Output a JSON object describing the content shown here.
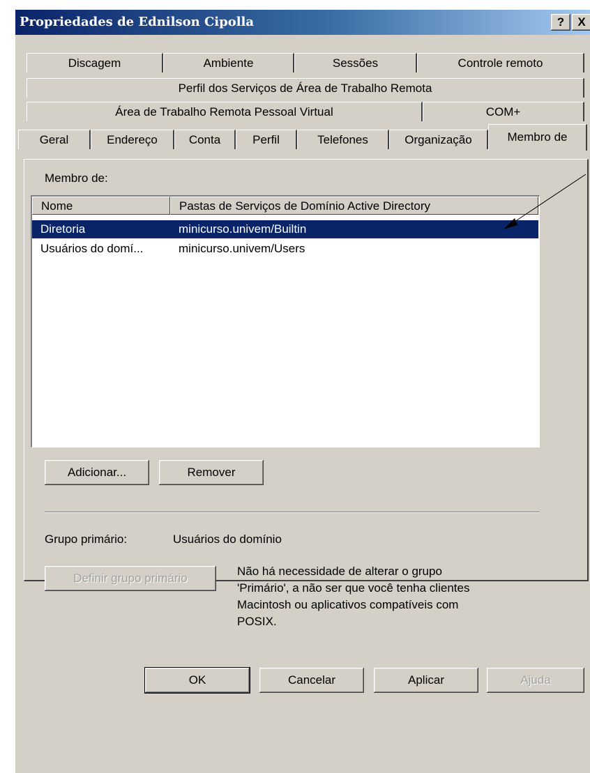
{
  "window": {
    "title": "Propriedades de Ednilson Cipolla",
    "help_button": "?",
    "close_button": "X"
  },
  "tabs": {
    "row1": [
      "Discagem",
      "Ambiente",
      "Sessões",
      "Controle remoto"
    ],
    "row2": [
      "Perfil dos Serviços de Área de Trabalho Remota"
    ],
    "row3": [
      "Área de Trabalho Remota Pessoal Virtual",
      "COM+"
    ],
    "row4": [
      "Geral",
      "Endereço",
      "Conta",
      "Perfil",
      "Telefones",
      "Organização",
      "Membro de"
    ],
    "selected": "Membro de"
  },
  "member_of": {
    "label": "Membro de:",
    "columns": [
      "Nome",
      "Pastas de Serviços de Domínio Active Directory"
    ],
    "rows": [
      {
        "name": "Diretoria",
        "folder": "minicurso.univem/Builtin",
        "selected": true
      },
      {
        "name": "Usuários do domí...",
        "folder": "minicurso.univem/Users",
        "selected": false
      }
    ],
    "add_button": "Adicionar...",
    "remove_button": "Remover"
  },
  "primary_group": {
    "label": "Grupo primário:",
    "value": "Usuários do domínio",
    "set_button": "Definir grupo primário",
    "note": "Não há necessidade de alterar o grupo\n'Primário', a não ser que você tenha clientes\nMacintosh ou aplicativos compatíveis com\nPOSIX."
  },
  "footer": {
    "ok": "OK",
    "cancel": "Cancelar",
    "apply": "Aplicar",
    "help": "Ajuda"
  },
  "colors": {
    "selection": "#0a246a",
    "dialog_bg": "#d4d0c8",
    "arrow": "#000000"
  }
}
